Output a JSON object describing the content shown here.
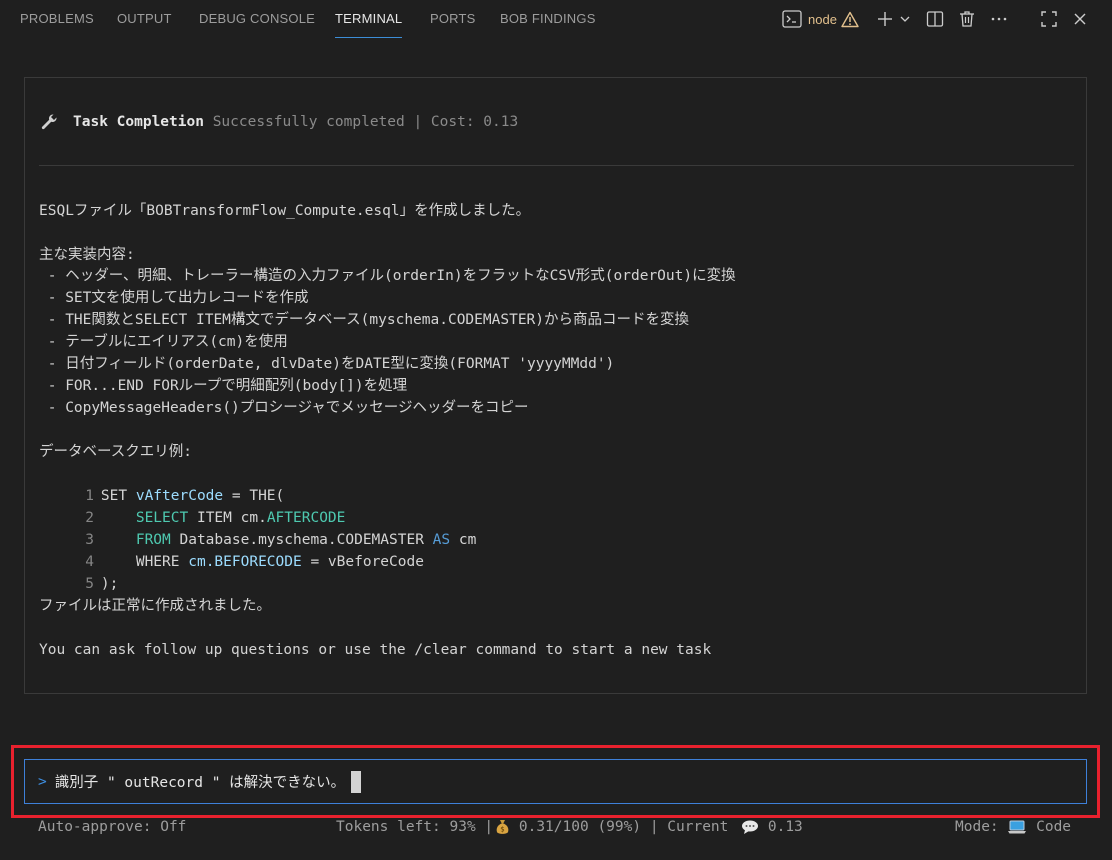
{
  "tabs": [
    {
      "label": "PROBLEMS",
      "active": false
    },
    {
      "label": "OUTPUT",
      "active": false
    },
    {
      "label": "DEBUG CONSOLE",
      "active": false
    },
    {
      "label": "TERMINAL",
      "active": true
    },
    {
      "label": "PORTS",
      "active": false
    },
    {
      "label": "BOB FINDINGS",
      "active": false
    }
  ],
  "terminal": {
    "name": "node",
    "icons": [
      "terminal-icon",
      "warning-icon",
      "add-icon",
      "chevron-down-icon",
      "split-icon",
      "trash-icon",
      "more-icon",
      "maximize-icon",
      "close-icon"
    ]
  },
  "task": {
    "icon": "wrench-icon",
    "title": "Task Completion",
    "status": "Successfully completed | Cost: 0.13",
    "intro": "ESQLファイル「BOBTransformFlow_Compute.esql」を作成しました。",
    "summary_heading": "主な実装内容:",
    "bullets": [
      " - ヘッダー、明細、トレーラー構造の入力ファイル(orderIn)をフラットなCSV形式(orderOut)に変換",
      " - SET文を使用して出力レコードを作成",
      " - THE関数とSELECT ITEM構文でデータベース(myschema.CODEMASTER)から商品コードを変換",
      " - テーブルにエイリアス(cm)を使用",
      " - 日付フィールド(orderDate, dlvDate)をDATE型に変換(FORMAT 'yyyyMMdd')",
      " - FOR...END FORループで明細配列(body[])を処理",
      " - CopyMessageHeaders()プロシージャでメッセージヘッダーをコピー"
    ],
    "query_heading": "データベースクエリ例:",
    "code": {
      "line_numbers": [
        "1",
        "2",
        "3",
        "4",
        "5"
      ],
      "l1": {
        "a": "SET ",
        "b": "vAfterCode",
        "c": " = THE("
      },
      "l2": {
        "a": "    ",
        "b": "SELECT",
        "c": " ITEM cm.",
        "d": "AFTERCODE"
      },
      "l3": {
        "a": "    ",
        "b": "FROM",
        "c": " Database.myschema.CODEMASTER ",
        "d": "AS",
        "e": " cm"
      },
      "l4": {
        "a": "    WHERE ",
        "b": "cm.BEFORECODE",
        "c": " = vBeforeCode"
      },
      "l5": {
        "a": ");"
      }
    },
    "done": "ファイルは正常に作成されました。",
    "followup": "You can ask follow up questions or use the /clear command to start a new task"
  },
  "input": {
    "prompt": ">",
    "value": "識別子 \" outRecord \" は解決できない。"
  },
  "status": {
    "auto_approve": "Auto-approve: Off",
    "tokens": "Tokens left: 93% |",
    "cost_icon": "money-bag-icon",
    "cost": " 0.31/100 (99%) | Current ",
    "current_icon": "speech-bubble-icon",
    "current": " 0.13",
    "mode_label": "Mode: ",
    "mode_icon": "laptop-icon",
    "mode": " Code"
  },
  "colors": {
    "accent": "#3e80d9",
    "warning": "#e2c08d",
    "highlight_border": "#e8212e",
    "keyword_cyan": "#4ec9b0",
    "keyword_blue": "#569cd6"
  }
}
